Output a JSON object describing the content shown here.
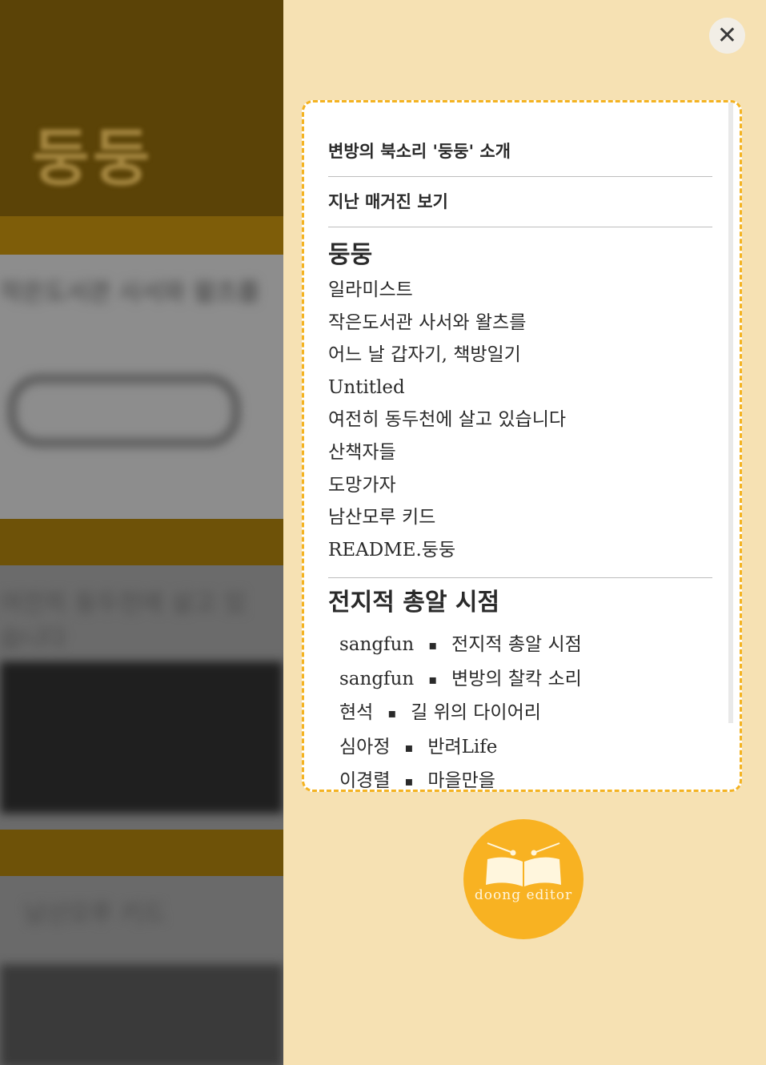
{
  "background": {
    "title": "둥둥",
    "panel_label_1": "작은도서관 사서와 왈츠를",
    "panel_label_2": "여전히 동두천에 살고 있습니다",
    "panel_label_3": "남산모루 키드"
  },
  "menu": {
    "close_icon": "close-icon",
    "top_links": [
      {
        "label": "변방의 북소리 '둥둥' 소개"
      },
      {
        "label": "지난 매거진 보기"
      }
    ],
    "section1": {
      "title": "둥둥",
      "items": [
        "일라미스트",
        "작은도서관 사서와 왈츠를",
        "어느 날 갑자기, 책방일기",
        "Untitled",
        "여전히 동두천에 살고 있습니다",
        "산책자들",
        "도망가자",
        "남산모루 키드",
        "README.둥둥"
      ]
    },
    "section2": {
      "title": "전지적 총알 시점",
      "separator": "▪",
      "items": [
        {
          "author": "sangfun",
          "title": "전지적 총알 시점"
        },
        {
          "author": "sangfun",
          "title": "변방의 찰칵 소리"
        },
        {
          "author": "현석",
          "title": "길 위의 다이어리"
        },
        {
          "author": "심아정",
          "title": "반려Life"
        },
        {
          "author": "이경렬",
          "title": "마을만을"
        }
      ]
    }
  },
  "logo": {
    "text": "doong editor",
    "icon": "open-book-icon",
    "color": "#f8b222"
  },
  "colors": {
    "panel_bg": "#f6e1b3",
    "accent": "#f4b322",
    "left_bg": "#5b4307"
  }
}
